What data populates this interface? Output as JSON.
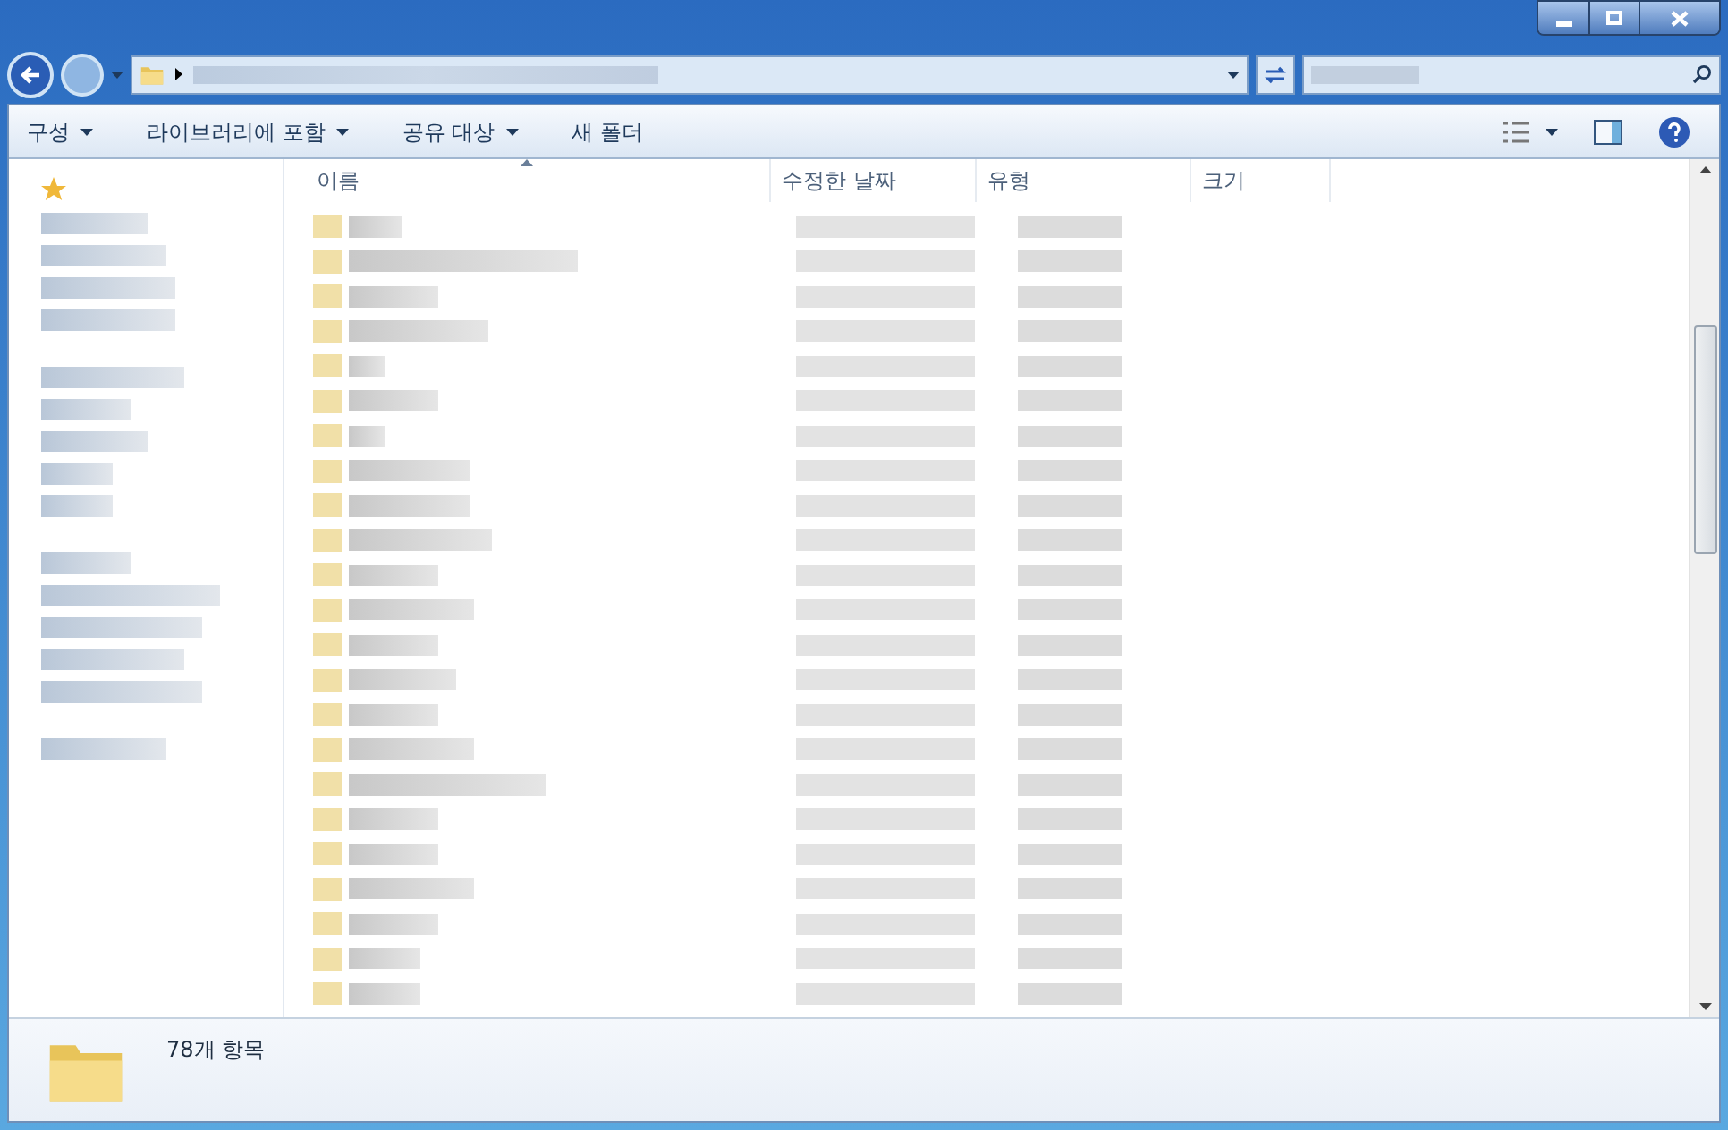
{
  "toolbar": {
    "items": [
      {
        "label": "구성",
        "dropdown": true
      },
      {
        "label": "라이브러리에 포함",
        "dropdown": true
      },
      {
        "label": "공유 대상",
        "dropdown": true
      },
      {
        "label": "새 폴더",
        "dropdown": false
      }
    ]
  },
  "file_list": {
    "columns": [
      {
        "label": "이름",
        "sorted": true
      },
      {
        "label": "수정한 날짜",
        "sorted": false
      },
      {
        "label": "유형",
        "sorted": false
      },
      {
        "label": "크기",
        "sorted": false
      }
    ]
  },
  "details_pane": {
    "item_count": "78개 항목"
  }
}
